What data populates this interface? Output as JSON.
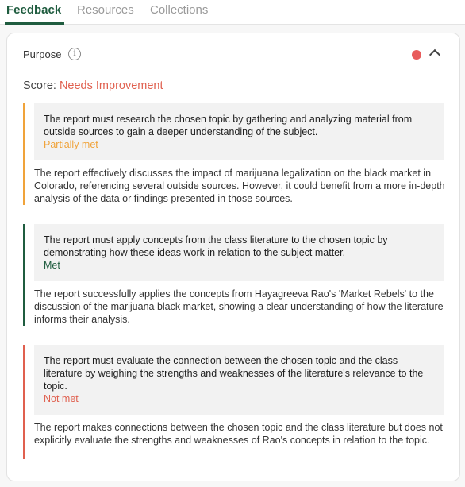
{
  "tabs": [
    {
      "label": "Feedback",
      "active": true
    },
    {
      "label": "Resources",
      "active": false
    },
    {
      "label": "Collections",
      "active": false
    }
  ],
  "section": {
    "title": "Purpose",
    "info_icon": "info-icon",
    "status_color": "#e85c5c",
    "score_prefix": "Score:",
    "score_value": "Needs Improvement",
    "score_color": "#e0604f"
  },
  "criteria": [
    {
      "requirement": "The report must research the chosen topic by gathering and analyzing material from outside sources to gain a deeper understanding of the subject.",
      "status": "Partially met",
      "status_color": "#f0a33a",
      "description": "The report effectively discusses the impact of marijuana legalization on the black market in Colorado, referencing several outside sources. However, it could benefit from a more in-depth analysis of the data or findings presented in those sources."
    },
    {
      "requirement": "The report must apply concepts from the class literature to the chosen topic by demonstrating how these ideas work in relation to the subject matter.",
      "status": "Met",
      "status_color": "#1f5c3f",
      "description": "The report successfully applies the concepts from Hayagreeva Rao's 'Market Rebels' to the discussion of the marijuana black market, showing a clear understanding of how the literature informs their analysis."
    },
    {
      "requirement": "The report must evaluate the connection between the chosen topic and the class literature by weighing the strengths and weaknesses of the literature's relevance to the topic.",
      "status": "Not met",
      "status_color": "#e0604f",
      "description": "The report makes connections between the chosen topic and the class literature but does not explicitly evaluate the strengths and weaknesses of Rao's concepts in relation to the topic."
    }
  ]
}
